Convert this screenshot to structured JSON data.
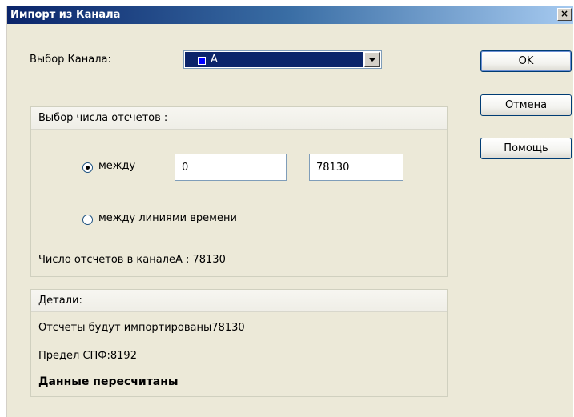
{
  "window": {
    "title": "Импорт из Канала",
    "close_glyph": "×"
  },
  "channel": {
    "label": "Выбор Канала:",
    "selected": "A",
    "swatch_color": "#0000ff"
  },
  "buttons": {
    "ok": "OK",
    "cancel": "Отмена",
    "help": "Помощь"
  },
  "samples": {
    "header": "Выбор числа отсчетов :",
    "between_label": "между",
    "from_value": "0",
    "to_value": "78130",
    "timelines_label": "между линиями времени",
    "selected_option": "between",
    "count_text": "Число отсчетов в каналеA : 78130"
  },
  "details": {
    "header": "Детали:",
    "import_text": "Отсчеты будут импортированы78130",
    "limit_text": "Предел СПФ:8192",
    "status_text": "Данные пересчитаны"
  }
}
